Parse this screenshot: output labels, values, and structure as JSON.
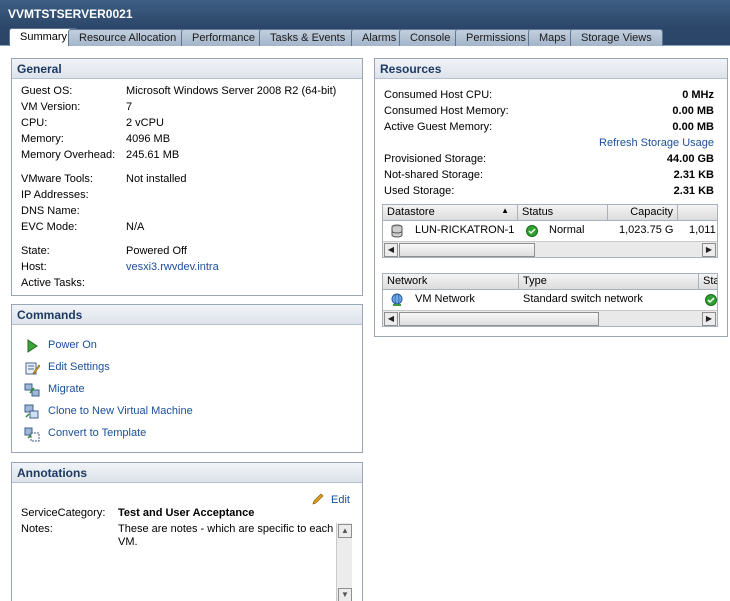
{
  "window": {
    "title": "VVMTSTSERVER0021"
  },
  "tabs": [
    "Summary",
    "Resource Allocation",
    "Performance",
    "Tasks & Events",
    "Alarms",
    "Console",
    "Permissions",
    "Maps",
    "Storage Views"
  ],
  "general": {
    "header": "General",
    "guest_os_label": "Guest OS:",
    "guest_os": "Microsoft Windows Server 2008 R2 (64-bit)",
    "vm_version_label": "VM Version:",
    "vm_version": "7",
    "cpu_label": "CPU:",
    "cpu": "2 vCPU",
    "memory_label": "Memory:",
    "memory": "4096 MB",
    "mem_overhead_label": "Memory Overhead:",
    "mem_overhead": "245.61 MB",
    "vmware_tools_label": "VMware Tools:",
    "vmware_tools": "Not installed",
    "ip_label": "IP Addresses:",
    "dns_label": "DNS Name:",
    "evc_label": "EVC Mode:",
    "evc": "N/A",
    "state_label": "State:",
    "state": "Powered Off",
    "host_label": "Host:",
    "host": "vesxi3.rwvdev.intra",
    "tasks_label": "Active Tasks:"
  },
  "commands": {
    "header": "Commands",
    "power_on": "Power On",
    "edit_settings": "Edit Settings",
    "migrate": "Migrate",
    "clone": "Clone to New Virtual Machine",
    "convert": "Convert to Template"
  },
  "annotations": {
    "header": "Annotations",
    "edit": "Edit",
    "service_label": "ServiceCategory:",
    "service_value": "Test and User Acceptance",
    "notes_label": "Notes:",
    "notes_value": "These are notes - which are specific to each VM."
  },
  "resources": {
    "header": "Resources",
    "host_cpu_label": "Consumed Host CPU:",
    "host_cpu": "0 MHz",
    "host_mem_label": "Consumed Host Memory:",
    "host_mem": "0.00 MB",
    "guest_mem_label": "Active Guest Memory:",
    "guest_mem": "0.00 MB",
    "refresh_link": "Refresh Storage Usage",
    "prov_label": "Provisioned Storage:",
    "prov": "44.00 GB",
    "nonshared_label": "Not-shared Storage:",
    "nonshared": "2.31 KB",
    "used_label": "Used Storage:",
    "used": "2.31 KB",
    "datastore_cols": [
      "Datastore",
      "Status",
      "Capacity",
      ""
    ],
    "datastore_row": {
      "name": "LUN-RICKATRON-1",
      "status": "Normal",
      "capacity": "1,023.75 G",
      "free": "1,011"
    },
    "network_cols": [
      "Network",
      "Type",
      "Sta"
    ],
    "network_row": {
      "name": "VM Network",
      "type": "Standard switch network"
    }
  }
}
